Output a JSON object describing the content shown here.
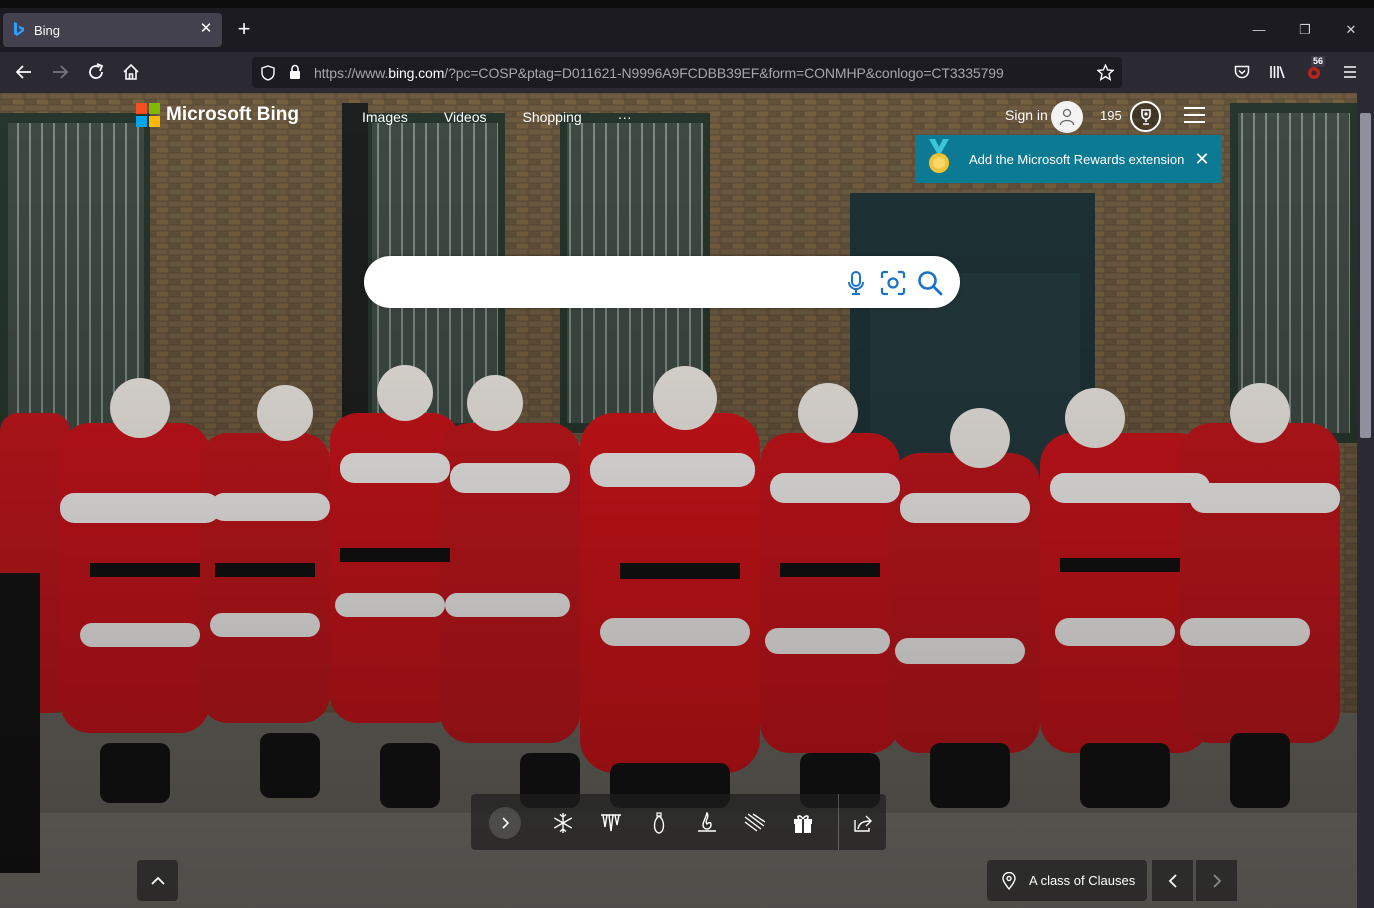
{
  "browser": {
    "tab_title": "Bing",
    "url_prefix": "https://www.",
    "url_host": "bing.com",
    "url_rest": "/?pc=COSP&ptag=D011621-N9996A9FCDBB39EF&form=CONMHP&conlogo=CT3335799",
    "extension_badge": "56"
  },
  "header": {
    "logo_text": "Microsoft Bing",
    "nav": [
      "Images",
      "Videos",
      "Shopping",
      "···"
    ],
    "signin_label": "Sign in",
    "points": "195"
  },
  "rewards_banner": {
    "text": "Add the Microsoft Rewards extension"
  },
  "search": {
    "value": "",
    "placeholder": ""
  },
  "caption": {
    "text": "A class of Clauses"
  },
  "colors": {
    "rewards_bg": "#0d7a94",
    "tab_bg": "#42414d",
    "nav_bg": "#2b2a33"
  }
}
